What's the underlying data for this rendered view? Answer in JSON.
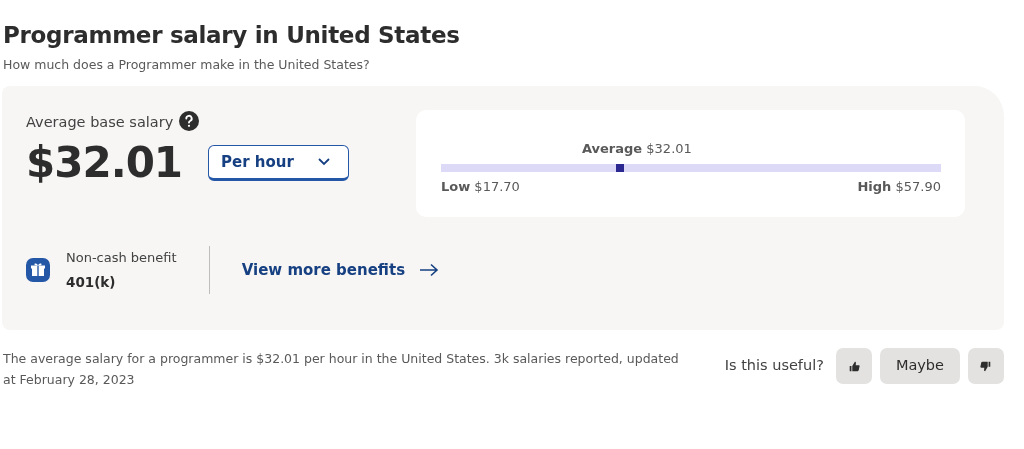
{
  "title": "Programmer salary in United States",
  "subtitle": "How much does a Programmer make in the United States?",
  "salary": {
    "label": "Average base salary",
    "amount": "$32.01",
    "period": "Per hour"
  },
  "range": {
    "average": "**Average** $32.01",
    "low": "**Low** $17.70",
    "high": "**High** $57.90",
    "level": 0.358
  },
  "benefit": {
    "label": "Non-cash benefit",
    "value": "401(k)",
    "link": "View more benefits"
  },
  "summary": "The average salary for a programmer is $32.01 per hour in the United States.  3k salaries reported, updated at February 28, 2023",
  "feedback": {
    "question": "Is this useful?",
    "buttons": [
      {
        "kind": "up"
      },
      {
        "kind": "text",
        "label": "Maybe"
      },
      {
        "kind": "down"
      }
    ]
  }
}
